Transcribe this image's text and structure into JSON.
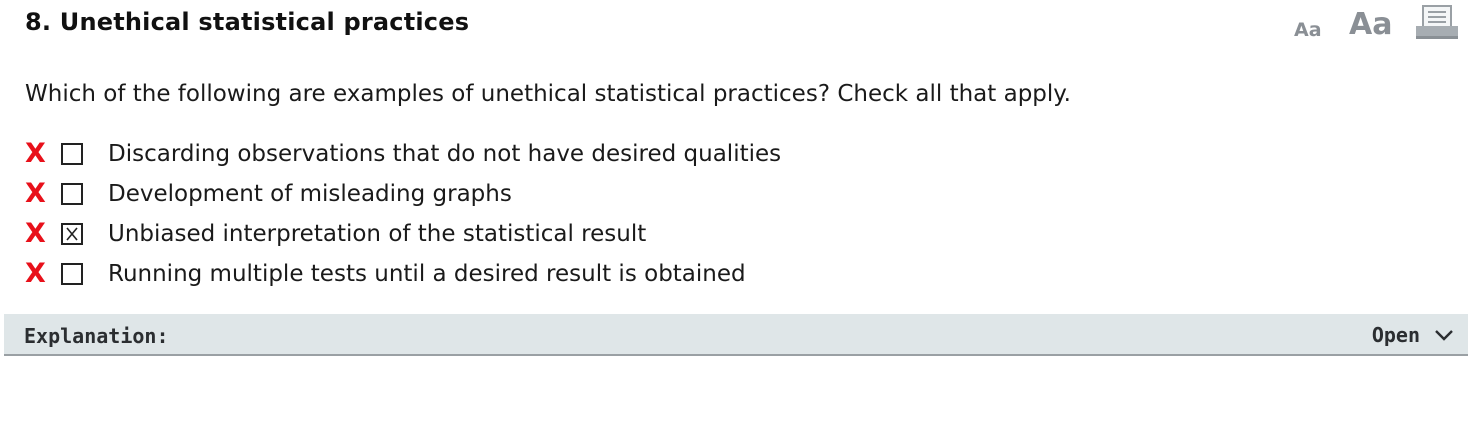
{
  "question": {
    "title": "8.  Unethical statistical practices",
    "prompt": "Which of the following are examples of unethical statistical practices? Check all that apply.",
    "options": [
      {
        "label": "Discarding observations that do not have desired qualities",
        "checked": false,
        "result": "incorrect"
      },
      {
        "label": "Development of misleading graphs",
        "checked": false,
        "result": "incorrect"
      },
      {
        "label": "Unbiased interpretation of the statistical result",
        "checked": true,
        "result": "incorrect"
      },
      {
        "label": "Running multiple tests until a desired result is obtained",
        "checked": false,
        "result": "incorrect"
      }
    ]
  },
  "toolbar": {
    "font_small_label": "Aa",
    "font_large_label": "Aa",
    "print_icon": "print-icon"
  },
  "explanation": {
    "label": "Explanation:",
    "toggle_label": "Open",
    "toggle_icon": "chevron-down-icon"
  },
  "colors": {
    "incorrect": "#e8101a",
    "panel_bg": "#dfe6e8",
    "tool_icon": "#8a8f95"
  },
  "marks": {
    "incorrect": "X"
  }
}
